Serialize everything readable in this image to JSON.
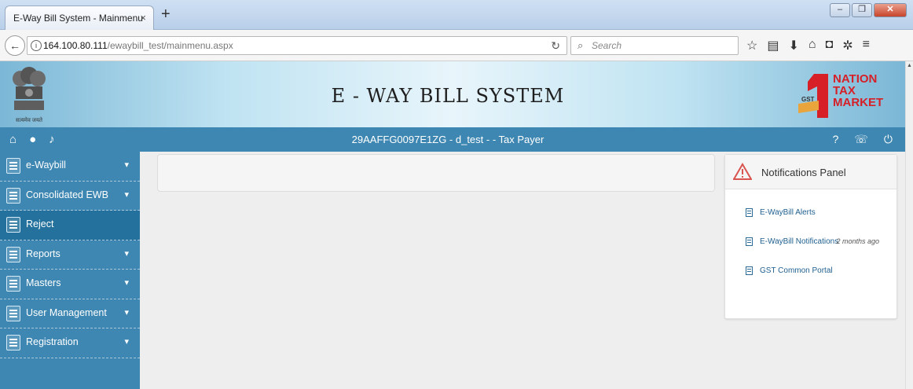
{
  "browser": {
    "tab_title": "E-Way Bill System - Mainmenu",
    "tab_close": "×",
    "new_tab": "+",
    "url_host": "164.100.80.111",
    "url_path": "/ewaybill_test/mainmenu.aspx",
    "search_placeholder": "Search",
    "window_buttons": [
      "–",
      "❐",
      "✕"
    ]
  },
  "header": {
    "title": "E - WAY BILL SYSTEM",
    "emblem_text": "सत्यमेव जयते",
    "brand_lines": [
      "NATION",
      "TAX",
      "MARKET"
    ],
    "brand_gst": "GST"
  },
  "userbar": {
    "user_info": "29AAFFG0097E1ZG - d_test - - Tax Payer"
  },
  "sidebar": {
    "items": [
      {
        "label": "e-Waybill",
        "has_chevron": true
      },
      {
        "label": "Consolidated EWB",
        "has_chevron": true
      },
      {
        "label": "Reject",
        "has_chevron": false
      },
      {
        "label": "Reports",
        "has_chevron": true
      },
      {
        "label": "Masters",
        "has_chevron": true
      },
      {
        "label": "User Management",
        "has_chevron": true
      },
      {
        "label": "Registration",
        "has_chevron": true
      }
    ],
    "active_index": 2
  },
  "notifications": {
    "title": "Notifications Panel",
    "items": [
      {
        "label": "E-WayBill Alerts",
        "time": ""
      },
      {
        "label": "E-WayBill Notifications",
        "time": "2 months ago"
      },
      {
        "label": "GST Common Portal",
        "time": ""
      }
    ]
  },
  "colors": {
    "primary_blue": "#3e87b2",
    "active_blue": "#23719c",
    "brand_red": "#d61f26"
  }
}
